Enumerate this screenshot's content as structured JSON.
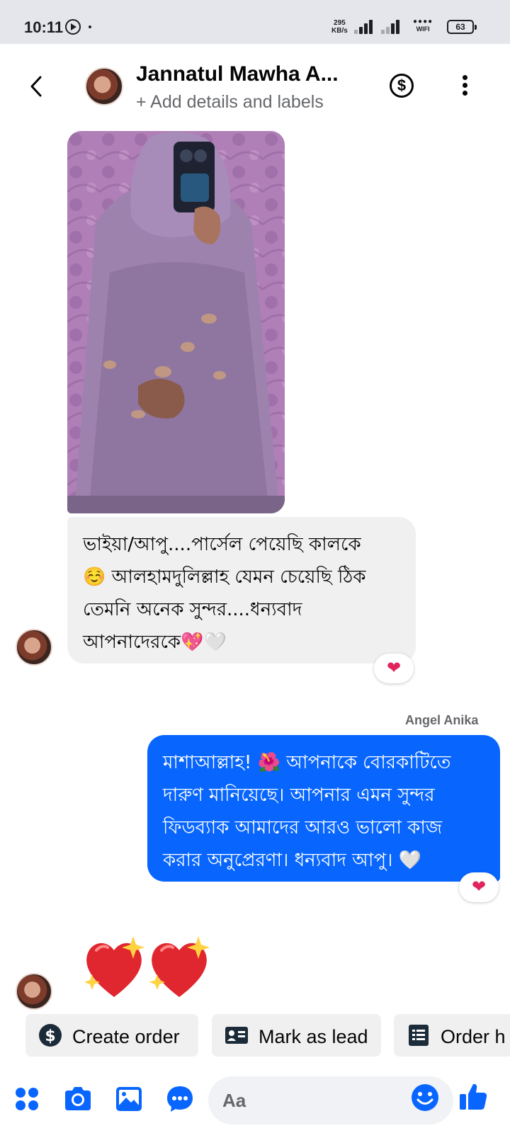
{
  "status_bar": {
    "time": "10:11",
    "speed_value": "295",
    "speed_unit": "KB/s",
    "wifi_label": "WIFI",
    "battery": "63"
  },
  "header": {
    "contact_name": "Jannatul Mawha A...",
    "subtitle": "+ Add details and labels",
    "payment_icon": "dollar-icon",
    "more_icon": "more-vertical-icon"
  },
  "messages": [
    {
      "type": "image",
      "direction": "incoming",
      "alt": "photo"
    },
    {
      "type": "text",
      "direction": "incoming",
      "lines": [
        "ভাইয়া/আপু....পার্সেল পেয়েছি কালকে",
        "☺️ আলহামদুলিল্লাহ যেমন চেয়েছি ঠিক",
        "তেমনি অনেক সুন্দর....ধন্যবাদ",
        "আপনাদেরকে💖🤍"
      ],
      "reaction": "❤"
    },
    {
      "type": "text",
      "direction": "outgoing",
      "sender": "Angel Anika",
      "lines": [
        "মাশাআল্লাহ! 🌺 আপনাকে বোরকাটিতে",
        "দারুণ মানিয়েছে। আপনার এমন সুন্দর",
        "ফিডব্যাক আমাদের আরও ভালো কাজ",
        "করার অনুপ্রেরণা। ধন্যবাদ আপু। 🤍"
      ],
      "reaction": "❤"
    },
    {
      "type": "emoji",
      "direction": "incoming",
      "emoji": "💖💖"
    }
  ],
  "quick_actions": [
    {
      "label": "Create order",
      "icon": "dollar-circle-icon"
    },
    {
      "label": "Mark as lead",
      "icon": "contact-card-icon"
    },
    {
      "label": "Order h",
      "icon": "order-history-icon"
    }
  ],
  "composer": {
    "placeholder": "Aa",
    "icons": [
      "apps-icon",
      "camera-icon",
      "gallery-icon",
      "chat-more-icon",
      "emoji-icon",
      "like-icon"
    ]
  },
  "colors": {
    "accent": "#0866ff",
    "incoming_bubble": "#f0f0f0",
    "reaction": "#e0245e"
  }
}
